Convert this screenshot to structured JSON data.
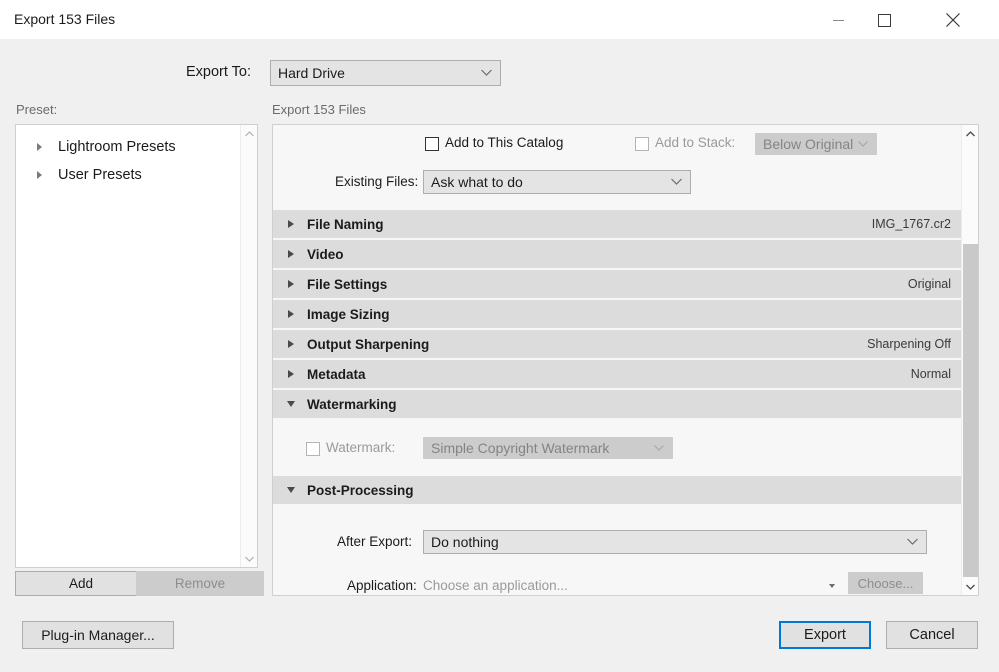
{
  "window": {
    "title": "Export 153 Files",
    "controls": {
      "minimize": "minimize-icon",
      "maximize": "maximize-icon",
      "close": "close-icon"
    }
  },
  "export_to": {
    "label": "Export To:",
    "value": "Hard Drive"
  },
  "preset": {
    "label": "Preset:",
    "items": [
      {
        "label": "Lightroom Presets",
        "expanded": false
      },
      {
        "label": "User Presets",
        "expanded": false
      }
    ],
    "add_label": "Add",
    "remove_label": "Remove",
    "remove_disabled": true
  },
  "main": {
    "header": "Export 153 Files",
    "add_to_catalog": {
      "label": "Add to This Catalog",
      "checked": false
    },
    "add_to_stack": {
      "label": "Add to Stack:",
      "checked": false,
      "disabled": true,
      "value": "Below Original"
    },
    "existing_files": {
      "label": "Existing Files:",
      "value": "Ask what to do"
    },
    "sections": [
      {
        "title": "File Naming",
        "value": "IMG_1767.cr2",
        "expanded": false
      },
      {
        "title": "Video",
        "value": "",
        "expanded": false
      },
      {
        "title": "File Settings",
        "value": "Original",
        "expanded": false
      },
      {
        "title": "Image Sizing",
        "value": "",
        "expanded": false
      },
      {
        "title": "Output Sharpening",
        "value": "Sharpening Off",
        "expanded": false
      },
      {
        "title": "Metadata",
        "value": "Normal",
        "expanded": false
      },
      {
        "title": "Watermarking",
        "value": "",
        "expanded": true
      },
      {
        "title": "Post-Processing",
        "value": "",
        "expanded": true
      }
    ],
    "watermarking": {
      "checkbox_label": "Watermark:",
      "checked": false,
      "value": "Simple Copyright Watermark",
      "disabled": true
    },
    "post_processing": {
      "after_export_label": "After Export:",
      "after_export_value": "Do nothing",
      "application_label": "Application:",
      "application_placeholder": "Choose an application...",
      "choose_label": "Choose...",
      "choose_disabled": true
    }
  },
  "footer": {
    "plugin_manager_label": "Plug-in Manager...",
    "export_label": "Export",
    "cancel_label": "Cancel"
  },
  "colors": {
    "accent": "#0078d7",
    "window_bg": "#f0f0f0",
    "panel_bg": "#f7f7f7",
    "section_bg": "#dcdcdc",
    "control_bg": "#e4e4e4",
    "disabled_bg": "#cccccc",
    "disabled_text": "#9a9a9a"
  }
}
